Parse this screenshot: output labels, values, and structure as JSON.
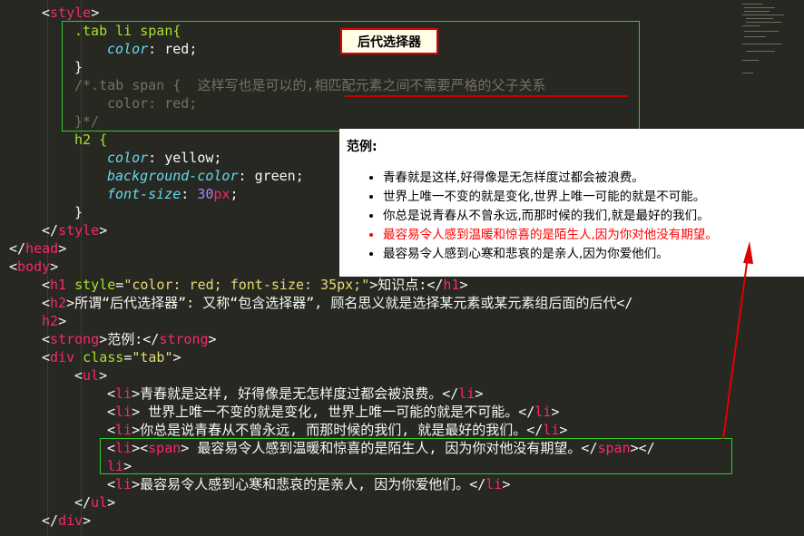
{
  "code": {
    "style_open": "style",
    "sel1": ".tab li span{",
    "prop_color": "color",
    "val_red": "red",
    "brace_close": "}",
    "comment_line1": "/*.tab span {  这样写也是可以的,相匹配元素之间不需要严格的父子关系",
    "comment_line2": "color: red;",
    "comment_line3": "}*/",
    "sel2": "h2 {",
    "val_yellow": "yellow",
    "prop_bg": "background-color",
    "val_green": "green",
    "prop_fs": "font-size",
    "num_30": "30",
    "unit_px": "px",
    "style_close": "style",
    "head_close": "head",
    "body_open": "body",
    "h1_tag": "h1",
    "h1_attr": "style",
    "h1_style_val": "\"color: red; font-size: 35px;\"",
    "h1_text": "知识点:",
    "h2_tag": "h2",
    "h2_text": "所谓“后代选择器”: 又称“包含选择器”, 顾名思义就是选择某元素或某元素组后面的后代",
    "strong_tag": "strong",
    "strong_text": "范例:",
    "div_tag": "div",
    "div_attr": "class",
    "div_class_val": "\"tab\"",
    "ul_tag": "ul",
    "li_tag": "li",
    "span_tag": "span",
    "li1_text": "青春就是这样, 好得像是无怎样度过都会被浪费。",
    "li2_text": " 世界上唯一不变的就是变化, 世界上唯一可能的就是不可能。",
    "li3_text": "你总是说青春从不曾永远, 而那时候的我们, 就是最好的我们。",
    "li4_text": " 最容易令人感到温暖和惊喜的是陌生人, 因为你对他没有期望。",
    "li5_text": "最容易令人感到心寒和悲哀的是亲人, 因为你爱他们。"
  },
  "annotation": {
    "label": "后代选择器"
  },
  "preview": {
    "title": "范例:",
    "items": [
      "青春就是这样,好得像是无怎样度过都会被浪费。",
      "世界上唯一不变的就是变化,世界上唯一可能的就是不可能。",
      "你总是说青春从不曾永远,而那时候的我们,就是最好的我们。",
      "最容易令人感到温暖和惊喜的是陌生人,因为你对他没有期望。",
      "最容易令人感到心寒和悲哀的是亲人,因为你爱他们。"
    ]
  },
  "colors": {
    "editor_bg": "#272822",
    "tag": "#f92672",
    "highlight_box": "#32c832",
    "annotation_red": "#e00000",
    "preview_red": "#ff0000"
  }
}
